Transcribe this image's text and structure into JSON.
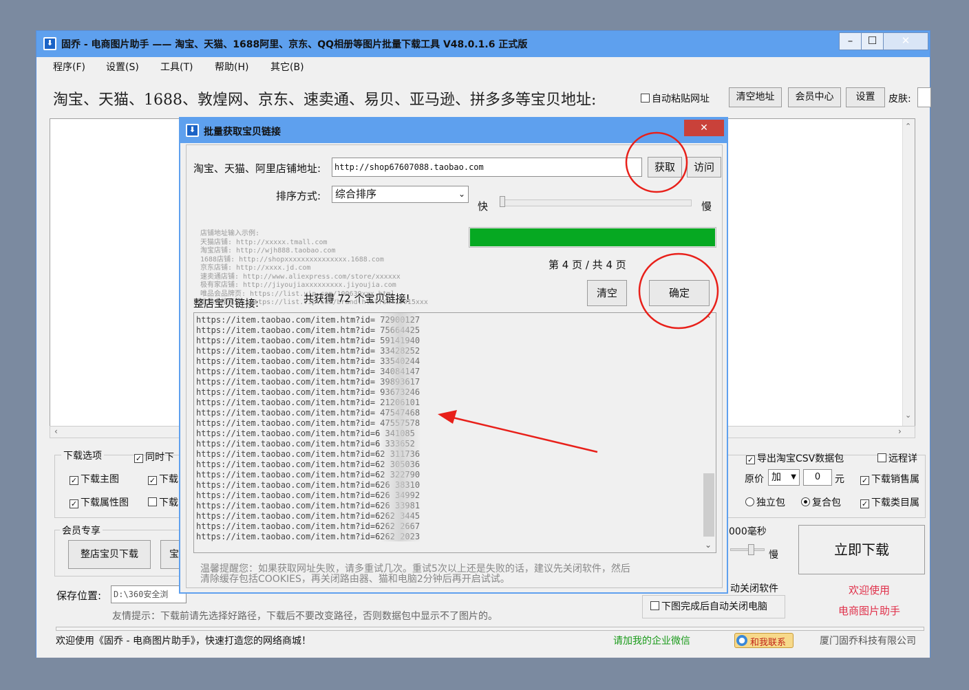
{
  "window": {
    "title": "固乔 - 电商图片助手 —— 淘宝、天猫、1688阿里、京东、QQ相册等图片批量下载工具 V48.0.1.6 正式版",
    "min": "–",
    "max": "☐",
    "close": "✕"
  },
  "menu": [
    "程序(F)",
    "设置(S)",
    "工具(T)",
    "帮助(H)",
    "其它(B)"
  ],
  "top": {
    "address_label": "淘宝、天猫、1688、敦煌网、京东、速卖通、易贝、亚马逊、拼多多等宝贝地址:",
    "auto_paste": "自动粘贴网址",
    "clear_btn": "清空地址",
    "member_btn": "会员中心",
    "settings_btn": "设置",
    "skin_label": "皮肤:"
  },
  "options": {
    "group_title": "下载选项",
    "sync": "同时下",
    "main_img": "下载主图",
    "dl2": "下载",
    "attr_img": "下载属性图",
    "dl3": "下载",
    "csv": "导出淘宝CSV数据包",
    "remote": "远程详",
    "price_label": "原价",
    "price_op": "加",
    "price_val": "0",
    "price_unit": "元",
    "sales": "下载销售属",
    "single": "独立包",
    "combo": "复合包",
    "category": "下载类目属"
  },
  "member": {
    "group_title": "会员专享",
    "shop_btn": "整店宝贝下载",
    "btn2": "宝"
  },
  "speed": {
    "ms": "000毫秒",
    "slow": "慢"
  },
  "download_btn": "立即下载",
  "welcome1": "欢迎使用",
  "welcome2": "电商图片助手",
  "save": {
    "label": "保存位置:",
    "path": "D:\\360安全浏",
    "tip": "友情提示：下载前请先选择好路径，下载后不要改变路径，否则数据包中显示不了图片的。"
  },
  "close_opts": {
    "close_soft": "动关闭软件",
    "close_pc": "下图完成后自动关闭电脑"
  },
  "status": {
    "welcome": "欢迎使用《固乔 - 电商图片助手》，快速打造您的网络商城！",
    "wechat": "请加我的企业微信",
    "contact": "和我联系",
    "company": "厦门固乔科技有限公司"
  },
  "dialog": {
    "title": "批量获取宝贝链接",
    "close": "✕",
    "shop_label": "淘宝、天猫、阿里店铺地址:",
    "shop_url": "http://shop67607088.taobao.com",
    "fetch_btn": "获取",
    "visit_btn": "访问",
    "sort_label": "排序方式:",
    "sort_value": "综合排序",
    "fast": "快",
    "slow": "慢",
    "progress": 1.0,
    "page_info": "第 4 页 / 共 4 页",
    "clear_btn": "清空",
    "ok_btn": "确定",
    "hint": "店铺地址输入示例:\n天猫店铺: http://xxxxx.tmall.com\n淘宝店铺: http://wjh888.taobao.com\n1688店铺: http://shopxxxxxxxxxxxxxxx.1688.com\n京东店铺: http://xxxx.jd.com\n速卖通店铺: http://www.aliexpress.com/store/xxxxxx\n极有家店铺: http://jiyoujiaxxxxxxxxx.jiyoujia.com\n唯品会品牌页: https://list.vip.com/100639xxx.html\n唯品会搜索页: https://list.vip.com/brand.html?sn=10015xxx",
    "links_label": "整店宝贝链接:",
    "count_text": "共获得 72 个宝贝链接!",
    "links": [
      "https://item.taobao.com/item.htm?id=    72900127",
      "https://item.taobao.com/item.htm?id=    75664425",
      "https://item.taobao.com/item.htm?id=    59141940",
      "https://item.taobao.com/item.htm?id=    33428252",
      "https://item.taobao.com/item.htm?id=    33540244",
      "https://item.taobao.com/item.htm?id=    34084147",
      "https://item.taobao.com/item.htm?id=    39893617",
      "https://item.taobao.com/item.htm?id=    93673246",
      "https://item.taobao.com/item.htm?id=    21206101",
      "https://item.taobao.com/item.htm?id=    47547468",
      "https://item.taobao.com/item.htm?id=    47557578",
      "https://item.taobao.com/item.htm?id=6    341085",
      "https://item.taobao.com/item.htm?id=6    333652",
      "https://item.taobao.com/item.htm?id=62   311736",
      "https://item.taobao.com/item.htm?id=62   305036",
      "https://item.taobao.com/item.htm?id=62   322790",
      "https://item.taobao.com/item.htm?id=626  38310",
      "https://item.taobao.com/item.htm?id=626  34992",
      "https://item.taobao.com/item.htm?id=626  33981",
      "https://item.taobao.com/item.htm?id=6262  3445",
      "https://item.taobao.com/item.htm?id=6262  2667",
      "https://item.taobao.com/item.htm?id=6262  2023"
    ],
    "tip": "温馨提醒您：如果获取网址失败，请多重试几次。重试5次以上还是失败的话，建议先关闭软件，然后\n清除缓存包括COOKIES，再关闭路由器、猫和电脑2分钟后再开启试试。"
  },
  "colors": {
    "titlebar": "#5ea0ee",
    "progress": "#06a922",
    "annotation": "#e8201a",
    "green_text": "#1a9a1a",
    "red_text": "#e0304a"
  }
}
